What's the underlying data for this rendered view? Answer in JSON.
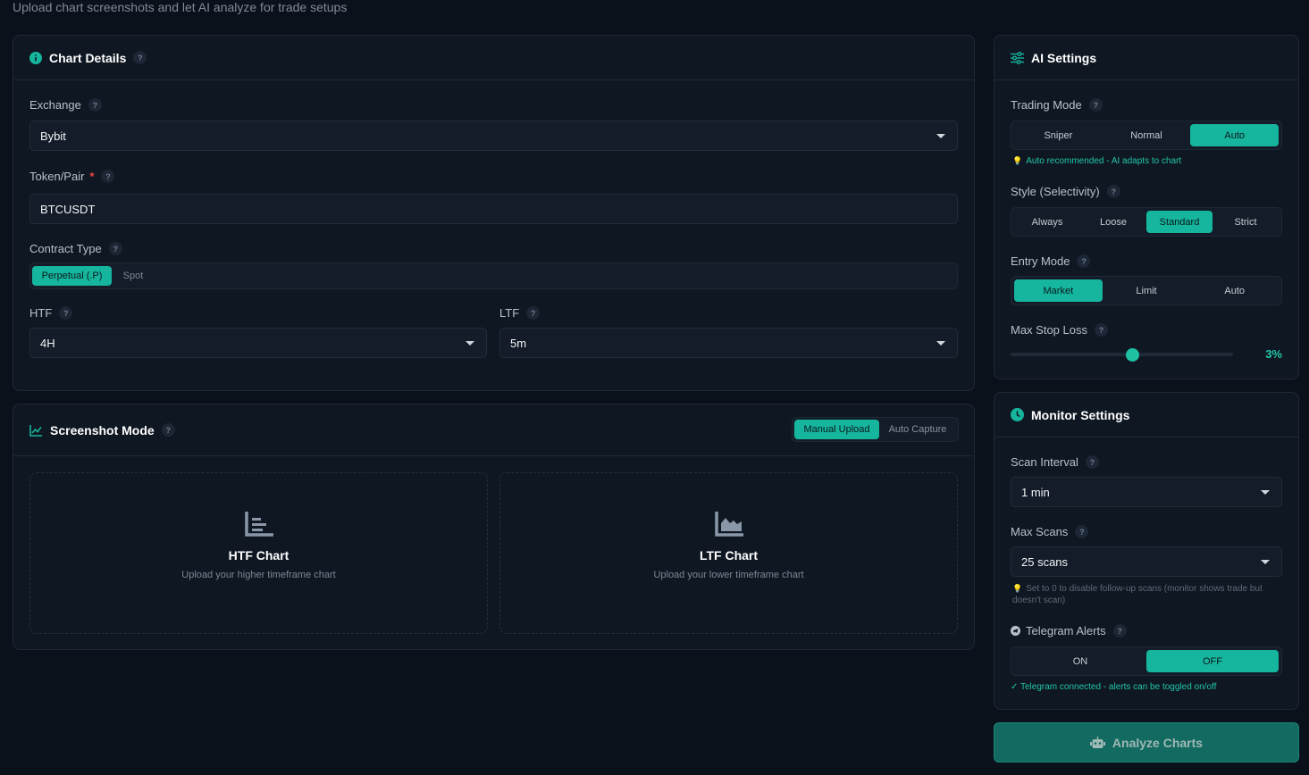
{
  "subtitle": "Upload chart screenshots and let AI analyze for trade setups",
  "chart_details": {
    "title": "Chart Details",
    "exchange": {
      "label": "Exchange",
      "value": "Bybit"
    },
    "token": {
      "label": "Token/Pair",
      "required_mark": "*",
      "value": "BTCUSDT"
    },
    "contract": {
      "label": "Contract Type",
      "options": [
        "Perpetual (.P)",
        "Spot"
      ],
      "selected": "Perpetual (.P)"
    },
    "htf": {
      "label": "HTF",
      "value": "4H"
    },
    "ltf": {
      "label": "LTF",
      "value": "5m"
    }
  },
  "screenshot_mode": {
    "title": "Screenshot Mode",
    "modes": [
      "Manual Upload",
      "Auto Capture"
    ],
    "selected": "Manual Upload",
    "htf_card": {
      "title": "HTF Chart",
      "subtitle": "Upload your higher timeframe chart",
      "icon": "bar-chart-icon"
    },
    "ltf_card": {
      "title": "LTF Chart",
      "subtitle": "Upload your lower timeframe chart",
      "icon": "area-chart-icon"
    }
  },
  "ai_settings": {
    "title": "AI Settings",
    "trading_mode": {
      "label": "Trading Mode",
      "options": [
        "Sniper",
        "Normal",
        "Auto"
      ],
      "selected": "Auto",
      "hint": "Auto recommended - AI adapts to chart"
    },
    "style": {
      "label": "Style (Selectivity)",
      "options": [
        "Always",
        "Loose",
        "Standard",
        "Strict"
      ],
      "selected": "Standard"
    },
    "entry_mode": {
      "label": "Entry Mode",
      "options": [
        "Market",
        "Limit",
        "Auto"
      ],
      "selected": "Market"
    },
    "max_stop_loss": {
      "label": "Max Stop Loss",
      "value_text": "3%",
      "level_fraction": 0.55
    }
  },
  "monitor_settings": {
    "title": "Monitor Settings",
    "scan_interval": {
      "label": "Scan Interval",
      "value": "1 min"
    },
    "max_scans": {
      "label": "Max Scans",
      "value": "25 scans",
      "hint": "Set to 0 to disable follow-up scans (monitor shows trade but doesn't scan)"
    },
    "telegram": {
      "label": "Telegram Alerts",
      "options": [
        "ON",
        "OFF"
      ],
      "selected": "OFF",
      "hint": "✓ Telegram connected - alerts can be toggled on/off"
    }
  },
  "analyze_button": "Analyze Charts",
  "help_mark": "?",
  "hint_bulb": "💡",
  "colors": {
    "accent": "#16b59e",
    "background": "#0b111a",
    "card": "#0f1722",
    "required": "#ef4444"
  }
}
